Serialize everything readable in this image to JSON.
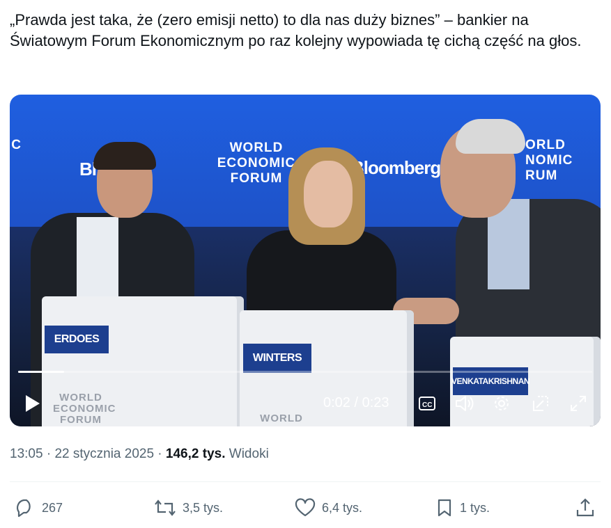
{
  "tweet": {
    "text": "„Prawda jest taka, że (zero emisji netto) to dla nas duży biznes” – bankier na Światowym Forum Ekonomicznym po raz kolejny wypowiada tę cichą część na głos."
  },
  "video": {
    "backdrop_logo_lines": [
      "WORLD",
      "ECONOMIC",
      "FORUM"
    ],
    "backdrop_brand": "Bloomberg",
    "backdrop_brand_partial_left": "Bl",
    "backdrop_logo_partial_left": "IC",
    "backdrop_logo_partial_right": [
      "ORLD",
      "NOMIC",
      "RUM"
    ],
    "nameplates": [
      "ERDOES",
      "WINTERS",
      "VENKATAKRISHNAN"
    ],
    "time_current": "0:02",
    "time_separator": " / ",
    "time_total": "0:23",
    "progress": 0.08,
    "icons": [
      "play-icon",
      "captions-icon",
      "volume-icon",
      "settings-icon",
      "popout-icon",
      "fullscreen-icon"
    ]
  },
  "meta": {
    "time": "13:05",
    "separator": " · ",
    "date": "22 stycznia 2025",
    "views_count": "146,2 tys.",
    "views_label": "Widoki"
  },
  "actions": {
    "replies": "267",
    "reposts": "3,5 tys.",
    "likes": "6,4 tys.",
    "bookmarks": "1 tys."
  },
  "colors": {
    "text": "#0f1419",
    "secondary": "#536471",
    "wef_blue": "#1f5fe0",
    "nameplate": "#1d3f8f"
  }
}
